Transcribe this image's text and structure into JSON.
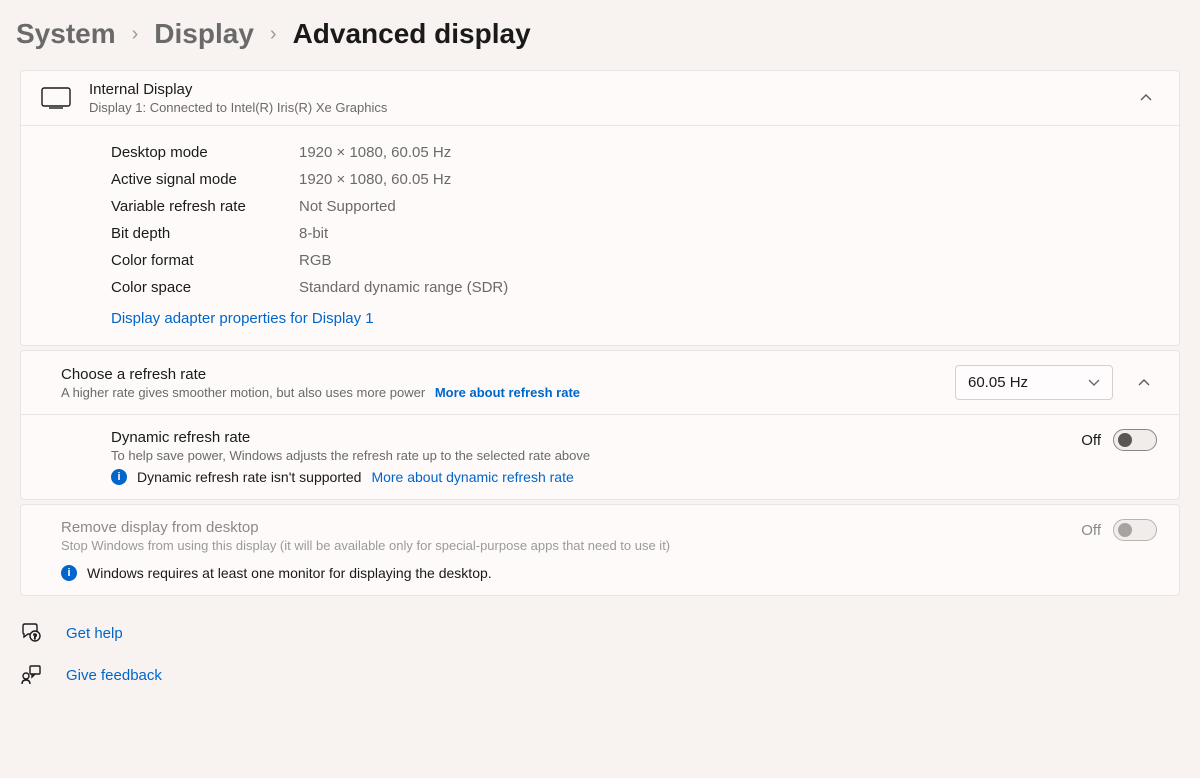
{
  "breadcrumb": {
    "system": "System",
    "display": "Display",
    "advanced": "Advanced display"
  },
  "displayCard": {
    "title": "Internal Display",
    "subtitle": "Display 1: Connected to Intel(R) Iris(R) Xe Graphics"
  },
  "info": {
    "labels": {
      "desktopMode": "Desktop mode",
      "activeSignal": "Active signal mode",
      "varRefresh": "Variable refresh rate",
      "bitDepth": "Bit depth",
      "colorFormat": "Color format",
      "colorSpace": "Color space"
    },
    "values": {
      "desktopMode": "1920 × 1080, 60.05 Hz",
      "activeSignal": "1920 × 1080, 60.05 Hz",
      "varRefresh": "Not Supported",
      "bitDepth": "8-bit",
      "colorFormat": "RGB",
      "colorSpace": "Standard dynamic range (SDR)"
    },
    "adapterLink": "Display adapter properties for Display 1"
  },
  "refreshRate": {
    "title": "Choose a refresh rate",
    "subtitle": "A higher rate gives smoother motion, but also uses more power",
    "moreLink": "More about refresh rate",
    "selected": "60.05 Hz"
  },
  "dynamicRefresh": {
    "title": "Dynamic refresh rate",
    "subtitle": "To help save power, Windows adjusts the refresh rate up to the selected rate above",
    "note": "Dynamic refresh rate isn't supported",
    "moreLink": "More about dynamic refresh rate",
    "toggleLabel": "Off"
  },
  "removeDisplay": {
    "title": "Remove display from desktop",
    "subtitle": "Stop Windows from using this display (it will be available only for special-purpose apps that need to use it)",
    "note": "Windows requires at least one monitor for displaying the desktop.",
    "toggleLabel": "Off"
  },
  "footer": {
    "help": "Get help",
    "feedback": "Give feedback"
  }
}
